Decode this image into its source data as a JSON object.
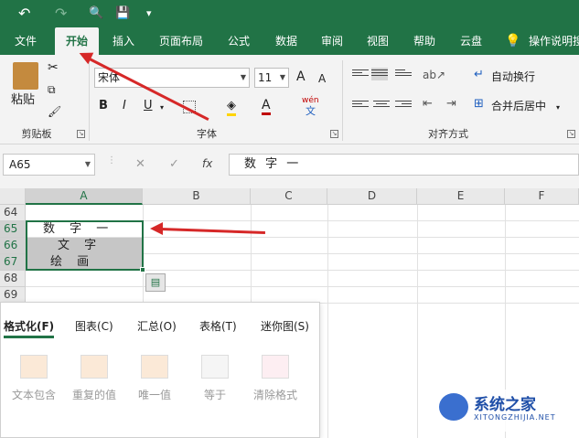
{
  "qat": {
    "undo": "↶",
    "redo": "↷",
    "preview": "🔍",
    "save": "💾",
    "more": "▾"
  },
  "tabs": [
    {
      "label": "文件"
    },
    {
      "label": "开始"
    },
    {
      "label": "插入"
    },
    {
      "label": "页面布局"
    },
    {
      "label": "公式"
    },
    {
      "label": "数据"
    },
    {
      "label": "审阅"
    },
    {
      "label": "视图"
    },
    {
      "label": "帮助"
    },
    {
      "label": "云盘"
    },
    {
      "label": "操作说明搜"
    }
  ],
  "ribbon": {
    "paste_label": "粘贴",
    "clipboard_group": "剪贴板",
    "font_name": "宋体",
    "font_size": "11",
    "font_group": "字体",
    "bold": "B",
    "italic": "I",
    "underline": "U",
    "wen": "wén",
    "wen_sub": "文",
    "wrap_text": "自动换行",
    "merge_center": "合并后居中",
    "align_group": "对齐方式",
    "grow": "A",
    "shrink": "A"
  },
  "formula_bar": {
    "name_box": "A65",
    "cancel": "✕",
    "enter": "✓",
    "fx": "fx",
    "content": "数 字 一"
  },
  "columns": [
    "A",
    "B",
    "C",
    "D",
    "E",
    "F"
  ],
  "rows": [
    "64",
    "65",
    "66",
    "67",
    "68",
    "69"
  ],
  "cells": {
    "a65": "数  字 一",
    "a66": "文 字",
    "a67": "绘  画"
  },
  "quick_analysis": {
    "tabs": [
      "格式化(F)",
      "图表(C)",
      "汇总(O)",
      "表格(T)",
      "迷你图(S)"
    ],
    "items": [
      "文本包含",
      "重复的值",
      "唯一值",
      "等于",
      "清除格式"
    ]
  },
  "watermark": {
    "title": "系统之家",
    "url": "XITONGZHIJIA.NET"
  },
  "colors": {
    "accent": "#217346",
    "arrow": "#d62828"
  }
}
